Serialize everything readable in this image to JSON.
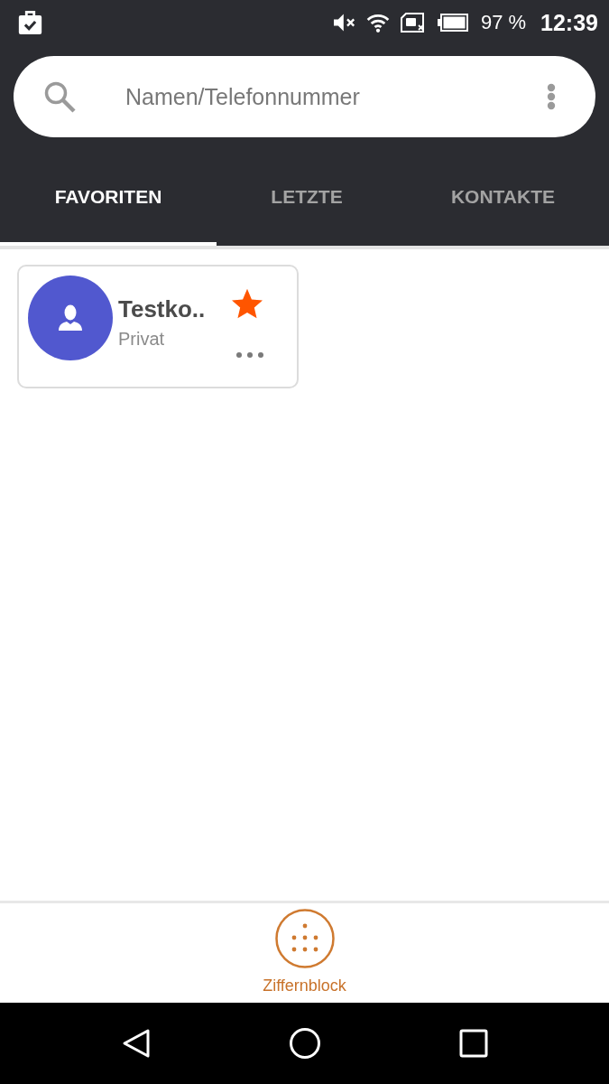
{
  "status_bar": {
    "battery_text": "97 %",
    "time": "12:39"
  },
  "search": {
    "placeholder": "Namen/Telefonnummer"
  },
  "tabs": [
    {
      "label": "FAVORITEN",
      "selected": true
    },
    {
      "label": "LETZTE",
      "selected": false
    },
    {
      "label": "KONTAKTE",
      "selected": false
    }
  ],
  "favorites": [
    {
      "name": "Testko..",
      "label": "Privat",
      "starred": true
    }
  ],
  "dialpad_button": {
    "label": "Ziffernblock"
  }
}
